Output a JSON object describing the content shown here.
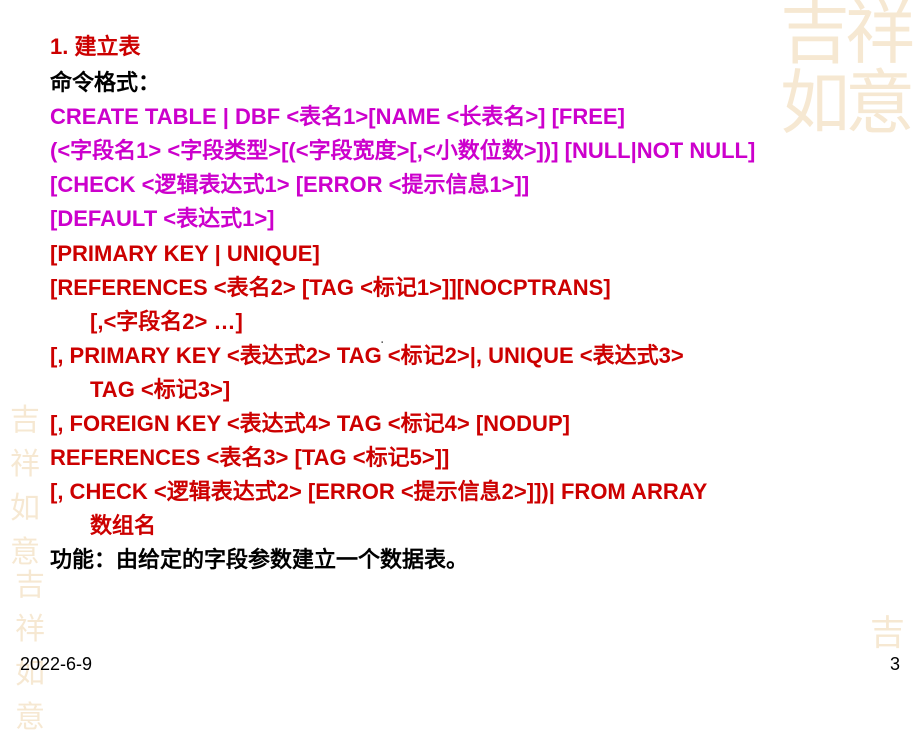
{
  "slide": {
    "title": "1.   建立表",
    "subtitle": "命令格式：",
    "line1": "CREATE TABLE | DBF <表名1>[NAME <长表名>] [FREE]",
    "line2": "(<字段名1> <字段类型>[(<字段宽度>[,<小数位数>])] [NULL|NOT NULL]",
    "line3": "[CHECK <逻辑表达式1> [ERROR <提示信息1>]]",
    "line4": "[DEFAULT <表达式1>]",
    "line5": "[PRIMARY KEY | UNIQUE]",
    "line6": "[REFERENCES <表名2> [TAG <标记1>]][NOCPTRANS]",
    "line7": "[,<字段名2> …]",
    "line8": "[, PRIMARY KEY <表达式2> TAG <标记2>|, UNIQUE <表达式3>",
    "line9": "TAG <标记3>]",
    "line10": "[, FOREIGN KEY <表达式4> TAG <标记4> [NODUP]",
    "line11": "REFERENCES <表名3> [TAG <标记5>]]",
    "line12": "[, CHECK <逻辑表达式2> [ERROR <提示信息2>]])| FROM ARRAY",
    "line13": "数组名",
    "footer_text": "功能：由给定的字段参数建立一个数据表。",
    "dot": "."
  },
  "footer": {
    "date": "2022-6-9",
    "page": "3"
  },
  "watermark": {
    "c1": "吉",
    "c2": "祥",
    "c3": "如",
    "c4": "意"
  }
}
